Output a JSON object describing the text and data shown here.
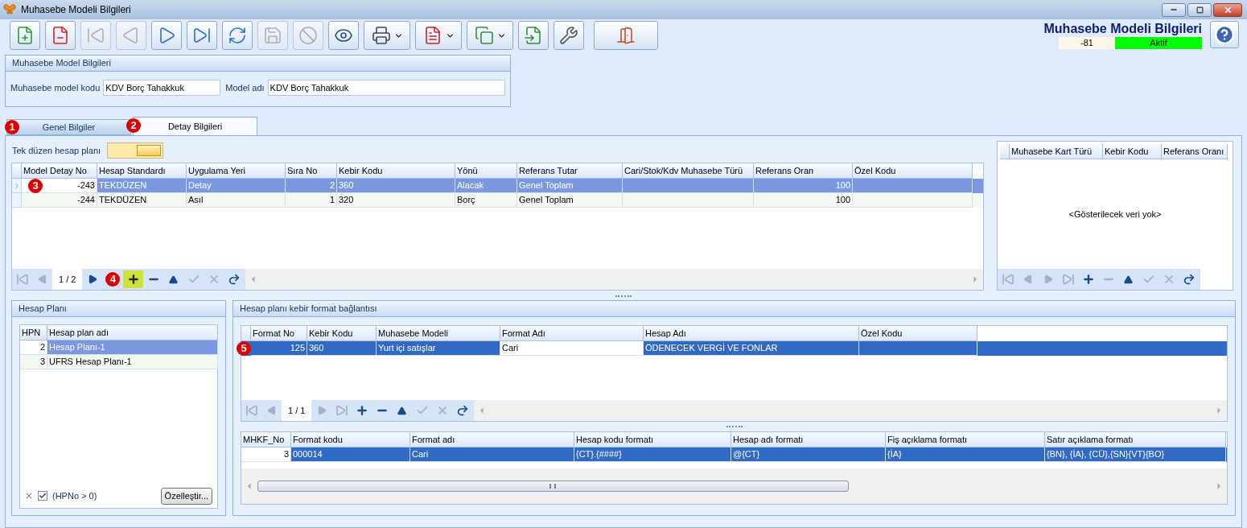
{
  "window": {
    "title": "Muhasebe Modeli Bilgileri"
  },
  "toolbar": {
    "buttons": [
      {
        "kind": "new",
        "disabled": false,
        "dropdown": false
      },
      {
        "kind": "delete",
        "disabled": false,
        "dropdown": false
      },
      {
        "kind": "first",
        "disabled": true,
        "dropdown": false
      },
      {
        "kind": "prev",
        "disabled": true,
        "dropdown": false
      },
      {
        "kind": "next",
        "disabled": false,
        "dropdown": false
      },
      {
        "kind": "last",
        "disabled": false,
        "dropdown": false
      },
      {
        "kind": "refresh",
        "disabled": false,
        "dropdown": false
      },
      {
        "kind": "save",
        "disabled": true,
        "dropdown": false
      },
      {
        "kind": "discard",
        "disabled": true,
        "dropdown": false
      },
      {
        "kind": "preview",
        "disabled": false,
        "dropdown": false
      },
      {
        "kind": "print",
        "disabled": false,
        "dropdown": true
      },
      {
        "kind": "pdf",
        "disabled": false,
        "dropdown": true
      },
      {
        "kind": "export",
        "disabled": false,
        "dropdown": true
      },
      {
        "kind": "import",
        "disabled": false,
        "dropdown": false
      },
      {
        "kind": "tools",
        "disabled": false,
        "dropdown": false
      },
      {
        "kind": "exit",
        "disabled": false,
        "dropdown": false
      }
    ]
  },
  "header": {
    "title": "Muhasebe Modeli Bilgileri",
    "record_no": "-81",
    "status": "Aktif"
  },
  "model_info": {
    "title": "Muhasebe Model Bilgileri",
    "fields": [
      {
        "label": "Muhasebe model kodu",
        "value": "KDV Borç Tahakkuk"
      },
      {
        "label": "Model adı",
        "value": "KDV Borç Tahakkuk"
      }
    ]
  },
  "tabs": [
    {
      "label": "Genel Bilgiler",
      "selected": false,
      "marker": "1"
    },
    {
      "label": "Detay Bilgileri",
      "selected": true,
      "marker": "2"
    }
  ],
  "detail": {
    "toggle": {
      "label": "Tek düzen hesap planı",
      "on": true
    },
    "grid": {
      "columns": [
        "Model Detay No",
        "Hesap Standardı",
        "Uygulama Yeri",
        "Sıra No",
        "Kebir Kodu",
        "Yönü",
        "Referans Tutar",
        "Cari/Stok/Kdv Muhasebe Türü",
        "Referans Oran",
        "Özel Kodu"
      ],
      "rows": [
        {
          "selected": true,
          "marker": "3",
          "cells": [
            {
              "text": "-243",
              "focused": true
            },
            {
              "text": "TEKDÜZEN",
              "focused": false
            },
            {
              "text": "Detay",
              "focused": false
            },
            {
              "text": "2",
              "focused": false
            },
            {
              "text": "360",
              "focused": false
            },
            {
              "text": "Alacak",
              "focused": false
            },
            {
              "text": "Genel Toplam",
              "focused": false
            },
            null,
            {
              "text": "100",
              "focused": false
            },
            null
          ]
        },
        {
          "selected": false,
          "cells": [
            "-244",
            "TEKDÜZEN",
            "Asıl",
            "1",
            "320",
            "Borç",
            "Genel Toplam",
            null,
            "100",
            null
          ]
        }
      ],
      "pager": {
        "page": "1 / 2",
        "marker": "4",
        "buttons": [
          {
            "kind": "first",
            "disabled": true,
            "highlighted": false
          },
          {
            "kind": "prev",
            "disabled": true,
            "highlighted": false
          },
          {
            "kind": "next",
            "disabled": false,
            "highlighted": false
          },
          {
            "kind": "add",
            "disabled": false,
            "highlighted": true
          },
          {
            "kind": "remove",
            "disabled": false,
            "highlighted": false
          },
          {
            "kind": "up",
            "disabled": false,
            "highlighted": false
          },
          {
            "kind": "apply",
            "disabled": true,
            "highlighted": false
          },
          {
            "kind": "cancel",
            "disabled": true,
            "highlighted": false
          },
          {
            "kind": "redo",
            "disabled": false,
            "highlighted": false
          }
        ]
      }
    },
    "side_grid": {
      "columns": [
        "Muhasebe Kart Türü",
        "Kebir Kodu",
        "Referans Oranı"
      ],
      "empty_text": "<Gösterilecek veri yok>",
      "pager": {
        "buttons": [
          {
            "kind": "first",
            "disabled": true,
            "highlighted": false
          },
          {
            "kind": "prev",
            "disabled": true,
            "highlighted": false
          },
          {
            "kind": "next",
            "disabled": true,
            "highlighted": false
          },
          {
            "kind": "last",
            "disabled": true,
            "highlighted": false
          },
          {
            "kind": "add",
            "disabled": false,
            "highlighted": false
          },
          {
            "kind": "remove",
            "disabled": true,
            "highlighted": false
          },
          {
            "kind": "up",
            "disabled": false,
            "highlighted": false
          },
          {
            "kind": "apply",
            "disabled": true,
            "highlighted": false
          },
          {
            "kind": "cancel",
            "disabled": true,
            "highlighted": false
          },
          {
            "kind": "redo",
            "disabled": false,
            "highlighted": false
          }
        ]
      }
    }
  },
  "hesap_plani": {
    "title": "Hesap Planı",
    "columns": [
      "HPN",
      "Hesap plan adı"
    ],
    "rows": [
      {
        "selected": true,
        "cells": [
          {
            "text": "2",
            "focused": true
          },
          {
            "text": "Hesap Planı-1",
            "focused": false
          }
        ]
      },
      {
        "selected": false,
        "cells": [
          "3",
          "UFRS Hesap Planı-1"
        ]
      }
    ],
    "filter": {
      "enabled": true,
      "text": "(HPNo > 0)"
    },
    "customize_button": "Özelleştir..."
  },
  "format_link": {
    "title": "Hesap planı kebir format bağlantısı",
    "grid": {
      "columns": [
        "Format No",
        "Kebir Kodu",
        "Muhasebe Modeli",
        "Format Adı",
        "Hesap Adı",
        "Özel Kodu"
      ],
      "rows": [
        {
          "selected": true,
          "marker": "5",
          "cells": [
            {
              "text": "125",
              "focused": false
            },
            {
              "text": "360",
              "focused": false
            },
            {
              "text": "Yurt içi satışlar",
              "focused": false
            },
            {
              "text": "Cari",
              "focused": true
            },
            {
              "text": "ÖDENECEK VERGİ VE FONLAR",
              "focused": false
            },
            null
          ]
        }
      ],
      "pager": {
        "page": "1 / 1",
        "buttons": [
          {
            "kind": "first",
            "disabled": true,
            "highlighted": false
          },
          {
            "kind": "prev",
            "disabled": true,
            "highlighted": false
          },
          {
            "kind": "next",
            "disabled": true,
            "highlighted": false
          },
          {
            "kind": "last",
            "disabled": true,
            "highlighted": false
          },
          {
            "kind": "add",
            "disabled": false,
            "highlighted": false
          },
          {
            "kind": "remove",
            "disabled": false,
            "highlighted": false
          },
          {
            "kind": "up",
            "disabled": false,
            "highlighted": false
          },
          {
            "kind": "apply",
            "disabled": true,
            "highlighted": false
          },
          {
            "kind": "cancel",
            "disabled": true,
            "highlighted": false
          },
          {
            "kind": "redo",
            "disabled": false,
            "highlighted": false
          }
        ]
      }
    },
    "format_grid": {
      "columns": [
        "MHKF_No",
        "Format kodu",
        "Format adı",
        "Hesap kodu formatı",
        "Hesap adı formatı",
        "Fiş açıklama formatı",
        "Satır açıklama formatı"
      ],
      "rows": [
        {
          "selected": true,
          "cells": [
            {
              "text": "3",
              "focused": true
            },
            {
              "text": "000014",
              "focused": false
            },
            {
              "text": "Cari",
              "focused": false
            },
            {
              "text": "{CT}.{####}",
              "focused": false
            },
            {
              "text": "@{CT}",
              "focused": false
            },
            {
              "text": "{İA}",
              "focused": false
            },
            {
              "text": "{BN}, {İA}, {CÜ},{SN}{VT}{BO}",
              "focused": false
            }
          ]
        }
      ]
    }
  }
}
